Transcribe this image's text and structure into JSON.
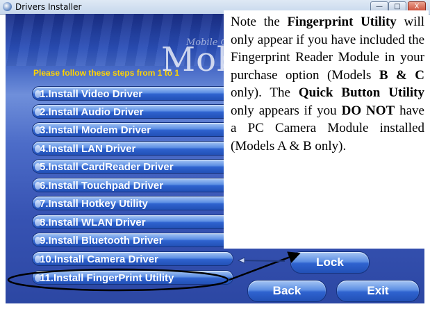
{
  "window": {
    "title": "Drivers Installer",
    "btn_min": "—",
    "btn_max": "□",
    "btn_close": "X"
  },
  "banner": {
    "brand_small": "Mobile Computing",
    "brand_large": "Mobi"
  },
  "instruction": "Please follow these steps from 1 to 1",
  "steps": [
    "1.Install Video Driver",
    "2.Install Audio Driver",
    "3.Install Modem Driver",
    "4.Install LAN Driver",
    "5.Install CardReader Driver",
    "6.Install Touchpad Driver",
    "7.Install Hotkey Utility",
    "8.Install WLAN Driver",
    "9.Install Bluetooth Driver",
    "10.Install Camera Driver",
    "11.Install FingerPrint Utility"
  ],
  "buttons": {
    "lock": "Lock",
    "back": "Back",
    "exit": "Exit"
  },
  "note": {
    "p1": "Note the ",
    "b1": "Fingerprint Utility",
    "p2": " will only appear if you have included the Fingerprint Reader Module in your purchase option (Models ",
    "b2": "B & C",
    "p3": " only). The ",
    "b3": "Quick Button Utility",
    "p4": " only appears if you ",
    "b4": "DO NOT",
    "p5": " have a PC Camera Module installed (Models A & B only)."
  },
  "colors": {
    "instruction": "#ffd400",
    "pill_top": "#a7c6f4",
    "pill_bottom": "#2250b6"
  }
}
